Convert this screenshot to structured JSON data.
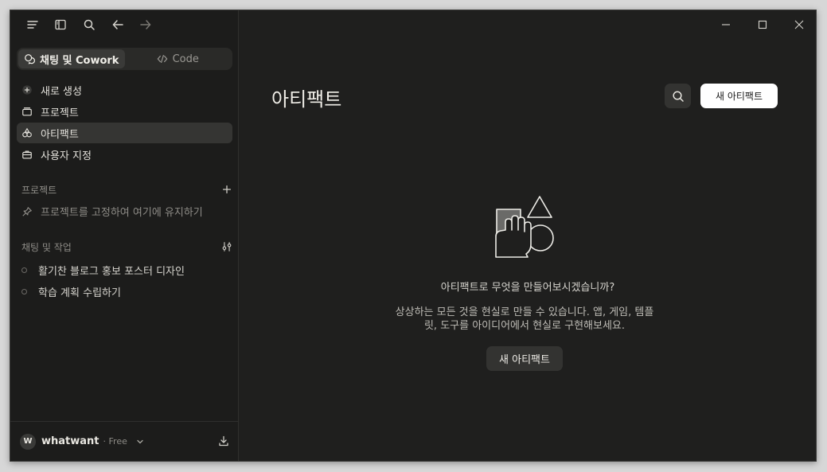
{
  "toolbar": {
    "icons": [
      "menu-icon",
      "sidebar-toggle-icon",
      "search-icon",
      "back-arrow-icon",
      "forward-arrow-icon"
    ]
  },
  "mode_switch": {
    "chat_label": "채팅 및 Cowork",
    "code_label": "Code"
  },
  "nav": {
    "items": [
      {
        "label": "새로 생성",
        "icon": "plus-circle-icon"
      },
      {
        "label": "프로젝트",
        "icon": "folder-icon"
      },
      {
        "label": "아티팩트",
        "icon": "shapes-icon"
      },
      {
        "label": "사용자 지정",
        "icon": "briefcase-icon"
      }
    ]
  },
  "projects": {
    "heading": "프로젝트",
    "pin_hint": "프로젝트를 고정하여 여기에 유지하기"
  },
  "chats": {
    "heading": "채팅 및 작업",
    "items": [
      {
        "label": "활기찬 블로그 홍보 포스터 디자인"
      },
      {
        "label": "학습 계획 수립하기"
      }
    ]
  },
  "user": {
    "initial": "W",
    "name": "whatwant",
    "plan": "· Free"
  },
  "main": {
    "title": "아티팩트",
    "new_button": "새 아티팩트",
    "empty": {
      "question": "아티팩트로 무엇을 만들어보시겠습니까?",
      "description": "상상하는 모든 것을 현실로 만들 수 있습니다. 앱, 게임, 템플릿, 도구를 아이디어에서 현실로 구현해보세요.",
      "button": "새 아티팩트"
    }
  },
  "colors": {
    "window_bg": "#1f1f1e",
    "sidebar_bg": "#1c1c1b",
    "active_item_bg": "#353533",
    "primary_button_bg": "#ffffff"
  }
}
